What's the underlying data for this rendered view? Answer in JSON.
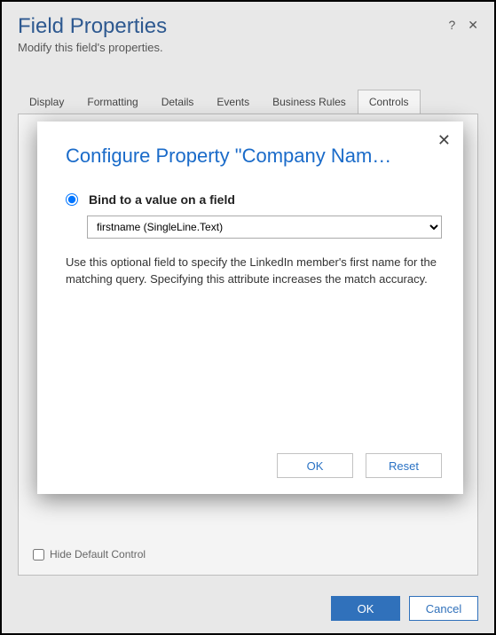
{
  "window": {
    "title": "Field Properties",
    "subtitle": "Modify this field's properties.",
    "help_icon": "?",
    "close_icon": "✕"
  },
  "tabs": [
    {
      "label": "Display"
    },
    {
      "label": "Formatting"
    },
    {
      "label": "Details"
    },
    {
      "label": "Events"
    },
    {
      "label": "Business Rules"
    },
    {
      "label": "Controls"
    }
  ],
  "hide_default_label": "Hide Default Control",
  "footer": {
    "ok": "OK",
    "cancel": "Cancel"
  },
  "modal": {
    "title": "Configure Property \"Company Nam…",
    "close_icon": "✕",
    "radio_label": "Bind to a value on a field",
    "select_value": "firstname (SingleLine.Text)",
    "description": "Use this optional field to specify the LinkedIn member's first name for the matching query. Specifying this attribute increases the match accuracy.",
    "ok": "OK",
    "reset": "Reset"
  }
}
